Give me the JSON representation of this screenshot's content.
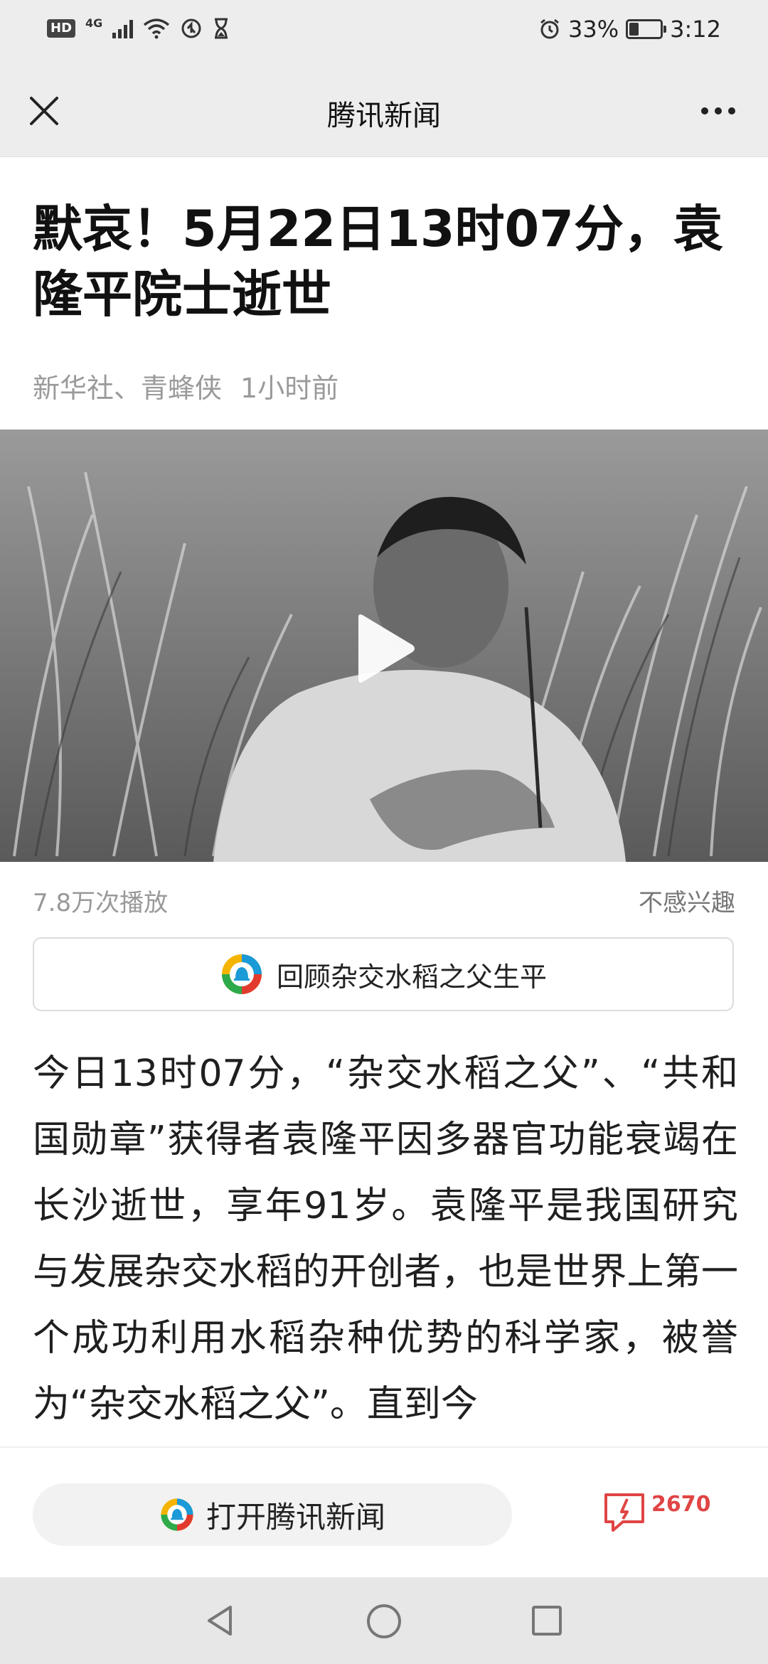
{
  "status_bar": {
    "hd": "HD",
    "network": "4G",
    "battery_percent": "33%",
    "battery_level": 0.33,
    "time": "3:12"
  },
  "app_bar": {
    "title": "腾讯新闻",
    "close_icon": "close-icon",
    "more_icon": "more-dots-icon"
  },
  "article": {
    "title": "默哀！5月22日13时07分，袁隆平院士逝世",
    "source": "新华社、青蜂侠",
    "time": "1小时前",
    "video": {
      "play_icon": "play-icon",
      "views": "7.8万次播放",
      "not_interested": "不感兴趣"
    },
    "review_button": "回顾杂交水稻之父生平",
    "body": "今日13时07分，“杂交水稻之父”、“共和国勋章”获得者袁隆平因多器官功能衰竭在长沙逝世，享年91岁。袁隆平是我国研究与发展杂交水稻的开创者，也是世界上第一个成功利用水稻杂种优势的科学家，被誉为“杂交水稻之父”。直到今"
  },
  "bottom_bar": {
    "open_app": "打开腾讯新闻",
    "comment_count": "2670",
    "comment_icon": "comment-icon"
  },
  "nav_bar": {
    "back_icon": "back-triangle-icon",
    "home_icon": "home-circle-icon",
    "recent_icon": "recent-square-icon"
  },
  "colors": {
    "header_bg": "#ededed",
    "accent_red": "#e04545",
    "muted_text": "#9a9a9a"
  }
}
